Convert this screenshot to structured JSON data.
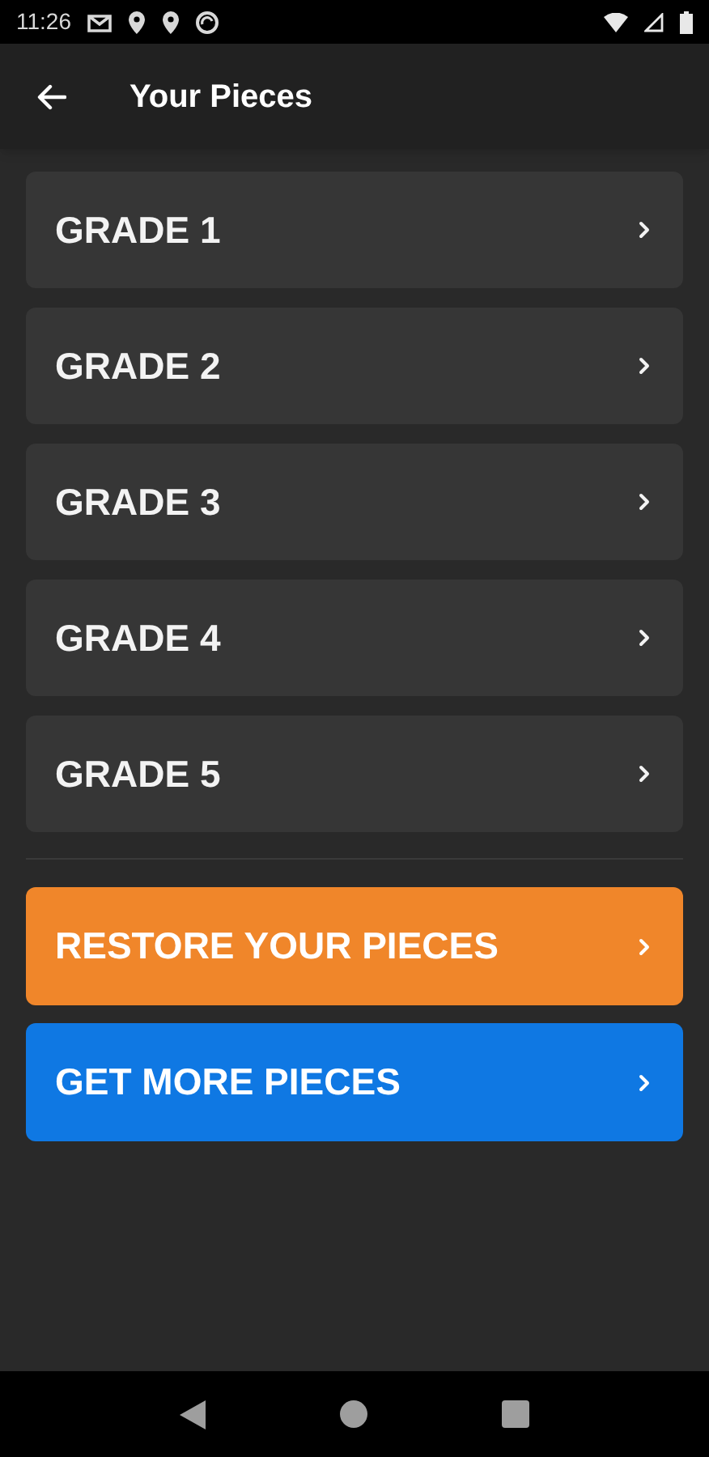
{
  "status_bar": {
    "time": "11:26"
  },
  "app_bar": {
    "title": "Your Pieces"
  },
  "grades": [
    {
      "label": "GRADE 1"
    },
    {
      "label": "GRADE 2"
    },
    {
      "label": "GRADE 3"
    },
    {
      "label": "GRADE 4"
    },
    {
      "label": "GRADE 5"
    }
  ],
  "actions": [
    {
      "label": "RESTORE YOUR PIECES",
      "color": "#f0862a"
    },
    {
      "label": "GET MORE PIECES",
      "color": "#0f78e3"
    }
  ]
}
